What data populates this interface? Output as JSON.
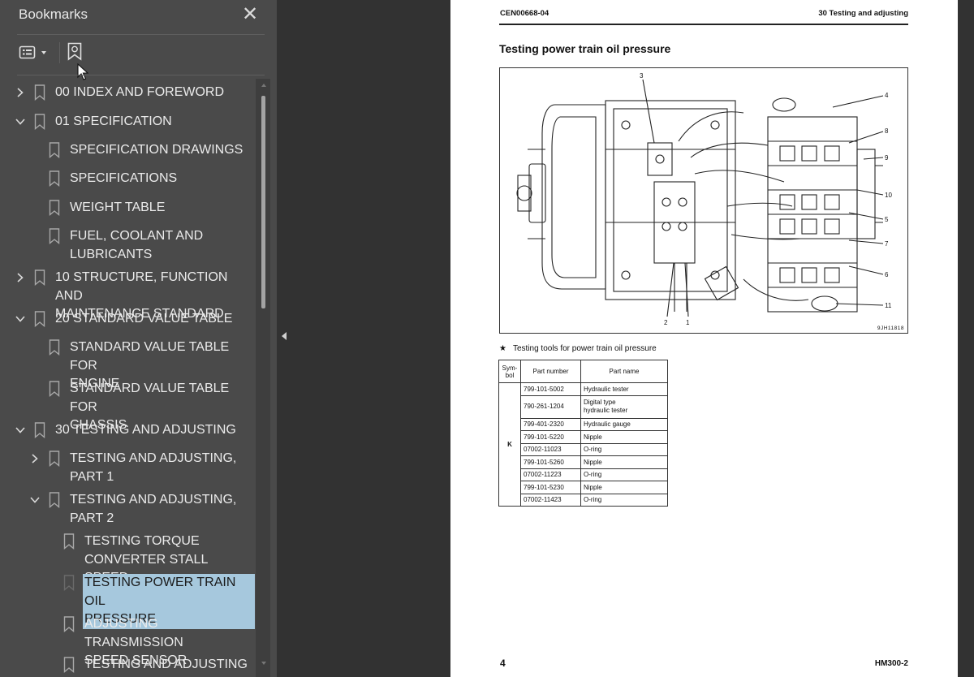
{
  "bookmarks_panel": {
    "title": "Bookmarks",
    "close_glyph": "✕",
    "toolbar": {
      "options_icon": "list-options-icon",
      "add_bookmark_icon": "bookmark-add-icon"
    },
    "items": [
      {
        "label": "00 INDEX AND FOREWORD",
        "toggle": "collapsed"
      },
      {
        "label": "01 SPECIFICATION",
        "toggle": "expanded"
      },
      {
        "label": "SPECIFICATION DRAWINGS",
        "toggle": "none"
      },
      {
        "label": "SPECIFICATIONS",
        "toggle": "none"
      },
      {
        "label": "WEIGHT TABLE",
        "toggle": "none"
      },
      {
        "label": "FUEL, COOLANT AND\nLUBRICANTS",
        "toggle": "none"
      },
      {
        "label": "10 STRUCTURE, FUNCTION AND\nMAINTENANCE STANDARD",
        "toggle": "collapsed"
      },
      {
        "label": "20 STANDARD VALUE TABLE",
        "toggle": "expanded"
      },
      {
        "label": "STANDARD VALUE TABLE FOR\nENGINE",
        "toggle": "none"
      },
      {
        "label": "STANDARD VALUE TABLE FOR\nCHASSIS",
        "toggle": "none"
      },
      {
        "label": "30 TESTING AND ADJUSTING",
        "toggle": "expanded"
      },
      {
        "label": "TESTING AND ADJUSTING,\nPART 1",
        "toggle": "collapsed"
      },
      {
        "label": "TESTING AND ADJUSTING,\nPART 2",
        "toggle": "expanded"
      },
      {
        "label": "TESTING TORQUE\nCONVERTER STALL SPEED",
        "toggle": "none"
      },
      {
        "label": "TESTING POWER TRAIN OIL\nPRESSURE",
        "toggle": "none",
        "selected": true
      },
      {
        "label": "ADJUSTING TRANSMISSION\nSPEED SENSOR",
        "toggle": "none"
      },
      {
        "label": "TESTING AND ADJUSTING",
        "toggle": "none"
      }
    ]
  },
  "document": {
    "header_left": "CEN00668-04",
    "header_right": "30 Testing and adjusting",
    "section_title": "Testing power train oil pressure",
    "figure": {
      "id": "9JH11818",
      "callouts": [
        "3",
        "4",
        "8",
        "9",
        "10",
        "5",
        "7",
        "6",
        "11",
        "2",
        "1"
      ]
    },
    "tools_caption_star": "★",
    "tools_caption": "Testing tools for power train oil pressure",
    "table": {
      "headers": [
        "Sym-\nbol",
        "Part number",
        "Part name"
      ],
      "symbol": "K",
      "rows": [
        {
          "part_number": "799-101-5002",
          "part_name": "Hydraulic tester"
        },
        {
          "part_number": "790-261-1204",
          "part_name": "Digital type\nhydraulic tester"
        },
        {
          "part_number": "799-401-2320",
          "part_name": "Hydraulic gauge"
        },
        {
          "part_number": "799-101-5220",
          "part_name": "Nipple"
        },
        {
          "part_number": "07002-11023",
          "part_name": "O-ring"
        },
        {
          "part_number": "799-101-5260",
          "part_name": "Nipple"
        },
        {
          "part_number": "07002-11223",
          "part_name": "O-ring"
        },
        {
          "part_number": "799-101-5230",
          "part_name": "Nipple"
        },
        {
          "part_number": "07002-11423",
          "part_name": "O-ring"
        }
      ]
    },
    "footer_page": "4",
    "footer_model": "HM300-2"
  },
  "colors": {
    "panel_bg": "#4a4a4a",
    "app_bg": "#323232",
    "selection": "#a6c8dd"
  }
}
